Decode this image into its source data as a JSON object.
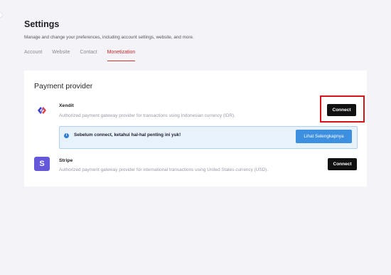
{
  "header": {
    "title": "Settings",
    "subtitle": "Manage and change your preferences, including account settings, website, and more."
  },
  "tabs": [
    {
      "label": "Account",
      "active": false
    },
    {
      "label": "Website",
      "active": false
    },
    {
      "label": "Contact",
      "active": false
    },
    {
      "label": "Monetization",
      "active": true
    }
  ],
  "payment": {
    "title": "Payment provider",
    "providers": [
      {
        "name": "Xendit",
        "description": "Authorized payment gateway provider for transactions using Indonesian currency (IDR).",
        "button_label": "Connect",
        "icon": "xendit-logo"
      },
      {
        "name": "Stripe",
        "description": "Authorized payment gateway provider for international transactions using United States currency (USD).",
        "button_label": "Connect",
        "icon": "stripe-logo",
        "icon_letter": "S"
      }
    ],
    "notice": {
      "text": "Sebelum connect, ketahui hal-hal penting ini yuk!",
      "button_label": "Lihat Selengkapnya",
      "icon": "info-icon",
      "icon_glyph": "i"
    }
  },
  "colors": {
    "accent": "#d32f2f",
    "highlight": "#d8141b",
    "notice_bg": "#e7f2fd",
    "notice_button": "#3d8fe0",
    "stripe_brand": "#6457d9"
  }
}
